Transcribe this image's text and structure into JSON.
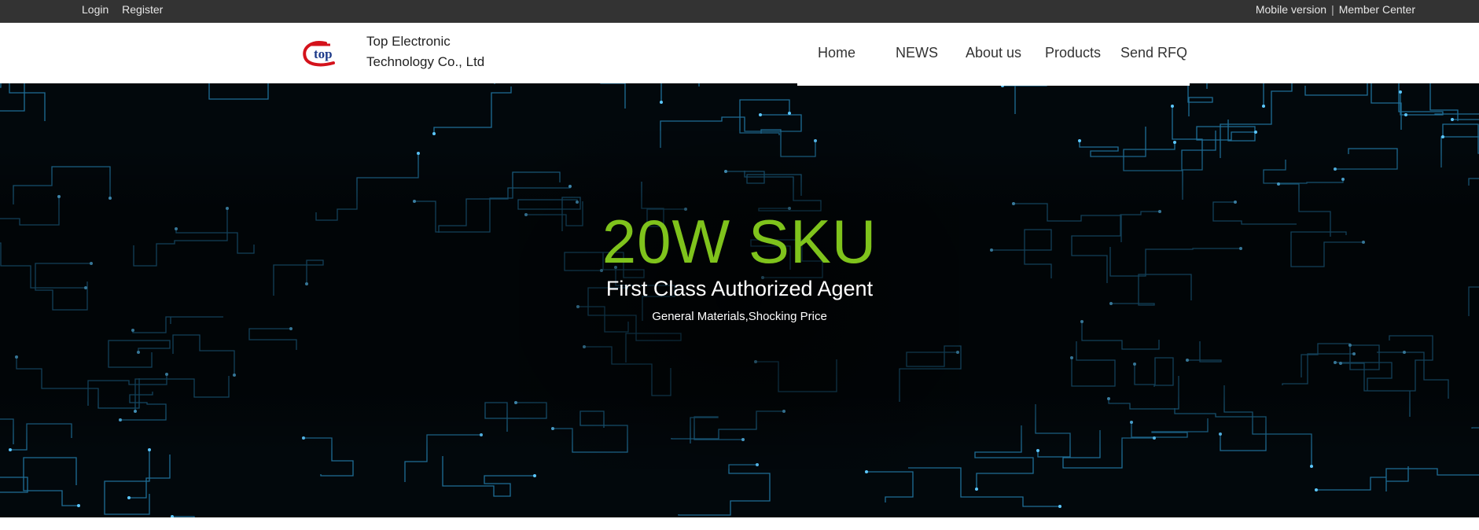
{
  "topbar": {
    "login": "Login",
    "register": "Register",
    "mobile_version": "Mobile version",
    "separator": "|",
    "member_center": "Member Center"
  },
  "header": {
    "logo_text": "top",
    "company_line1": "Top Electronic",
    "company_line2": "Technology Co., Ltd",
    "nav": [
      "Home",
      "NEWS",
      "About us",
      "Products",
      "Send RFQ"
    ]
  },
  "hero": {
    "title": "20W SKU",
    "subtitle": "First Class Authorized Agent",
    "tagline": "General Materials,Shocking Price"
  },
  "colors": {
    "topbar_bg": "#333333",
    "accent_green": "#7fc31c",
    "circuit_blue": "#2a8fc4",
    "logo_red": "#d4121b",
    "logo_blue": "#1d3a8a"
  }
}
